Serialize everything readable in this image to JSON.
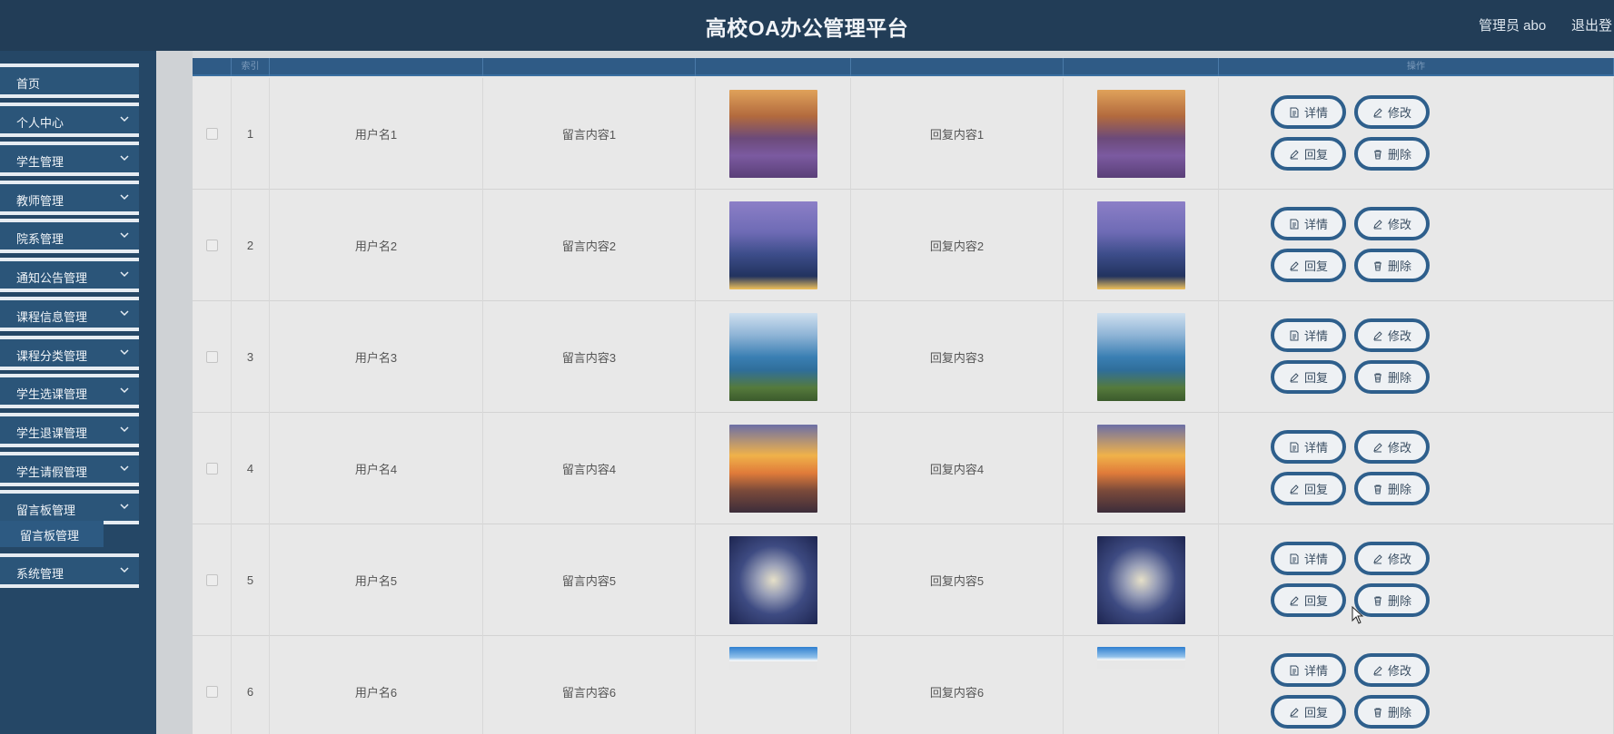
{
  "header": {
    "title": "高校OA办公管理平台",
    "user": "管理员 abo",
    "logout": "退出登"
  },
  "sidebar": {
    "items": [
      {
        "label": "首页",
        "chevron": false
      },
      {
        "label": "个人中心",
        "chevron": true
      },
      {
        "label": "学生管理",
        "chevron": true
      },
      {
        "label": "教师管理",
        "chevron": true
      },
      {
        "label": "院系管理",
        "chevron": true
      },
      {
        "label": "通知公告管理",
        "chevron": true
      },
      {
        "label": "课程信息管理",
        "chevron": true
      },
      {
        "label": "课程分类管理",
        "chevron": true
      },
      {
        "label": "学生选课管理",
        "chevron": true
      },
      {
        "label": "学生退课管理",
        "chevron": true
      },
      {
        "label": "学生请假管理",
        "chevron": true
      },
      {
        "label": "留言板管理",
        "chevron": true
      },
      {
        "label": "系统管理",
        "chevron": true
      }
    ],
    "submenu": {
      "label": "留言板管理"
    }
  },
  "table": {
    "headers": [
      "",
      "索引",
      "",
      "",
      "",
      "",
      "",
      "操作"
    ],
    "rows": [
      {
        "index": "1",
        "username": "用户名1",
        "message": "留言内容1",
        "reply": "回复内容1",
        "image": "lavender-sunset"
      },
      {
        "index": "2",
        "username": "用户名2",
        "message": "留言内容2",
        "reply": "回复内容2",
        "image": "pier-dusk"
      },
      {
        "index": "3",
        "username": "用户名3",
        "message": "留言内容3",
        "reply": "回复内容3",
        "image": "lake-island"
      },
      {
        "index": "4",
        "username": "用户名4",
        "message": "留言内容4",
        "reply": "回复内容4",
        "image": "harbor-sunset"
      },
      {
        "index": "5",
        "username": "用户名5",
        "message": "留言内容5",
        "reply": "回复内容5",
        "image": "starry-glow"
      },
      {
        "index": "6",
        "username": "用户名6",
        "message": "留言内容6",
        "reply": "回复内容6",
        "image": "sky-clouds"
      }
    ],
    "actions": {
      "detail": "详情",
      "edit": "修改",
      "reply": "回复",
      "delete": "删除"
    }
  },
  "colors": {
    "header_bg": "#223d57",
    "sidebar_bg": "#254766",
    "menu_item_bg": "#2b5579",
    "table_header_bg": "#2f5b86",
    "button_border": "#2e5f8c"
  }
}
